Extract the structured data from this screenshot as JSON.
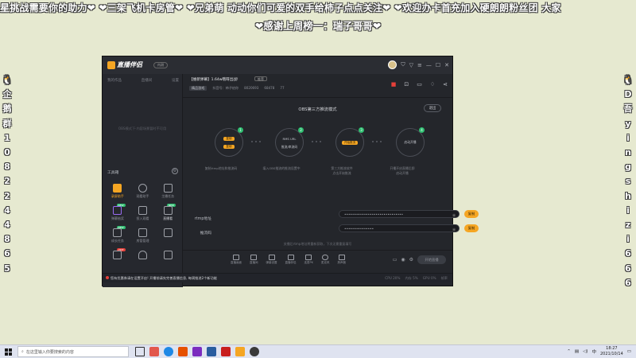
{
  "overlay": {
    "line1": "星挑战需要你的助力❤ ❤三架飞机卡房管❤ ❤兄弟萌 动动你们可爱的双手给柿子点点关注❤ ❤欢迎办卡首充加入硬朗朗粉丝团 大家",
    "line2": "❤感谢上周榜一：瑞子哥哥❤",
    "left_col": [
      "🐧",
      "企",
      "鹅",
      "群",
      "1",
      "0",
      "8",
      "2",
      "2",
      "4",
      "4",
      "8",
      "6",
      "5"
    ],
    "right_col": [
      "🐧",
      "D",
      "吾",
      "y",
      "i",
      "n",
      "g",
      "s",
      "h",
      "i",
      "z",
      "i",
      "6",
      "6",
      "6"
    ]
  },
  "app": {
    "logo_text": "直播伴侣",
    "version_badge": "内测",
    "titlebar_icons": [
      "shirt-icon",
      "filter-icon",
      "menu-icon",
      "minimize-icon",
      "maximize-icon",
      "close-icon"
    ],
    "sidebar": {
      "tabs": [
        "我的作品",
        "直播间",
        "设置"
      ],
      "empty_text": "OBS模式下·内容场景暂时不可用",
      "tools_title": "工具箱",
      "tools": [
        {
          "label": "录屏助手",
          "active": true,
          "icon": "record-icon",
          "badge": ""
        },
        {
          "label": "观看助手",
          "active": false,
          "icon": "viewer-icon",
          "badge": ""
        },
        {
          "label": "主播任务",
          "active": false,
          "icon": "task-icon",
          "badge": ""
        },
        {
          "label": "弹幕抽奖",
          "active": false,
          "icon": "lottery-icon",
          "badge": "NEW"
        },
        {
          "label": "投入观看",
          "active": false,
          "icon": "download-icon",
          "badge": ""
        },
        {
          "label": "直播看",
          "active": false,
          "icon": "screen-icon",
          "badge": "NEW"
        },
        {
          "label": "成长任务",
          "active": false,
          "icon": "growth-icon",
          "badge": "NEW"
        },
        {
          "label": "房管管理",
          "active": false,
          "icon": "admin-icon",
          "badge": ""
        },
        {
          "label": "",
          "active": false,
          "icon": "grid-icon",
          "badge": ""
        },
        {
          "label": "",
          "active": false,
          "icon": "gift-icon",
          "badge": "HOT"
        },
        {
          "label": "",
          "active": false,
          "icon": "crown-icon",
          "badge": ""
        },
        {
          "label": "",
          "active": false,
          "icon": "cat-icon",
          "badge": ""
        }
      ]
    },
    "live": {
      "title": "【维新弹幕】1.64w哦呀出战!",
      "tag": "推荐",
      "category": "精品游戏",
      "room_label": "抖音号：柿子给你",
      "id": "8020693",
      "fans": "68478",
      "likes": "77"
    },
    "mode_title": "OBS第三方推流模式",
    "switch_label": "退出",
    "steps": [
      {
        "num": "1",
        "inner": [
          "复制",
          "复制"
        ],
        "label": "复制rtmp地址和推流码"
      },
      {
        "num": "2",
        "inner": [
          "RMS URL",
          "推流/串流码"
        ],
        "label": "填入OBS推流的推流设置中"
      },
      {
        "num": "3",
        "inner": [
          "开始推流"
        ],
        "label": "第三方推流软件\n点击开始推流"
      },
      {
        "num": "4",
        "inner": [
          "启动开播"
        ],
        "label": "开播开启直播后即\n启动开播"
      }
    ],
    "form": {
      "rtmp_label": "rtmp地址",
      "rtmp_value": "••••••••••••••••••••••••••••••",
      "key_label": "推流码",
      "key_value": "•••••••••••••••",
      "copy_label": "复制",
      "hint": "关播后rtmp地址将重新获取，下次无需重复填写"
    },
    "bottom_tools": [
      "直播画面",
      "直播间",
      "弹幕设置",
      "直播伴侣",
      "连麦PK",
      "麦克风",
      "扬声器"
    ],
    "start_label": "开始直播",
    "notice": "您有优惠券请在设置开启! 开播前请先完善直播信息, 每周推进2个新功能",
    "notice_right": [
      "CPU 20%",
      "内存 5%",
      "GPU 0%",
      "帧率"
    ]
  },
  "taskbar": {
    "search_placeholder": "在这里输入你要搜索的内容",
    "apps": [
      "#2b2b2b",
      "#e2574c",
      "#1e88e5",
      "#e65100",
      "#7b2cbf",
      "#2a5d9f",
      "#c81e1e",
      "#f5a623",
      "#3a3a3a"
    ],
    "time": "18:27",
    "date": "2021/10/14",
    "ime": "中"
  }
}
